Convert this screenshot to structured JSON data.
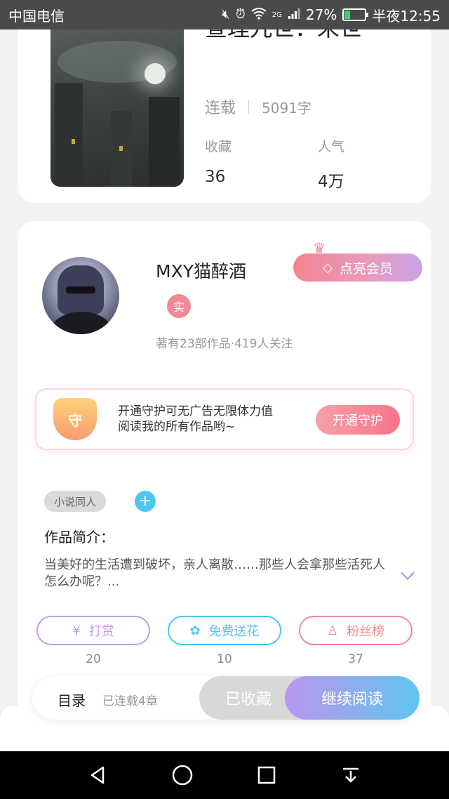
{
  "status_bar": {
    "carrier": "中国电信",
    "network": "2G",
    "battery_percent": "27%",
    "battery_level": 0.27,
    "time": "半夜12:55"
  },
  "book": {
    "title": "查理九世：末世",
    "status": "连载",
    "word_count": "5091字",
    "favorites_label": "收藏",
    "favorites_value": "36",
    "popularity_label": "人气",
    "popularity_value": "4万"
  },
  "author": {
    "name": "MXY猫醉酒",
    "real_badge": "实",
    "summary": "著有23部作品·419人关注",
    "vip_label": "点亮会员"
  },
  "guard": {
    "shield_text": "守",
    "line1": "开通守护可无广告无限体力值",
    "line2": "阅读我的所有作品哟~",
    "button": "开通守护"
  },
  "tags": {
    "tag1": "小说同人",
    "add": "+"
  },
  "intro": {
    "label": "作品简介：",
    "text": "当美好的生活遭到破坏，亲人离散……那些人会拿那些活死人怎么办呢？..."
  },
  "actions": [
    {
      "label": "打赏",
      "icon": "¥",
      "count": "20",
      "color": "#c59be8"
    },
    {
      "label": "免费送花",
      "icon": "✿",
      "count": "10",
      "color": "#4fc6ef"
    },
    {
      "label": "粉丝榜",
      "icon": "♙",
      "count": "37",
      "color": "#f08a8f"
    }
  ],
  "bottom_bar": {
    "toc": "目录",
    "chapters": "已连载4章",
    "favorited": "已收藏",
    "continue": "继续阅读"
  }
}
